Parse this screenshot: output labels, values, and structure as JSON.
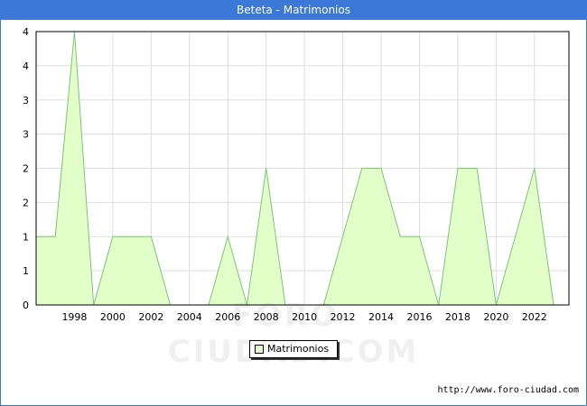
{
  "chart_data": {
    "type": "area",
    "title": "Beteta - Matrimonios",
    "xlabel": "",
    "ylabel": "",
    "x": [
      1996,
      1997,
      1998,
      1999,
      2000,
      2001,
      2002,
      2003,
      2004,
      2005,
      2006,
      2007,
      2008,
      2009,
      2010,
      2011,
      2012,
      2013,
      2014,
      2015,
      2016,
      2017,
      2018,
      2019,
      2020,
      2021,
      2022,
      2023
    ],
    "series": [
      {
        "name": "Matrimonios",
        "values": [
          1,
          1,
          4,
          0,
          1,
          1,
          1,
          0,
          0,
          0,
          1,
          0,
          2,
          0,
          0,
          0,
          1,
          2,
          2,
          1,
          1,
          0,
          2,
          2,
          0,
          1,
          2,
          0
        ]
      }
    ],
    "xlim": [
      1996,
      2023.8
    ],
    "ylim": [
      0,
      4
    ],
    "x_ticks": [
      1998,
      2000,
      2002,
      2004,
      2006,
      2008,
      2010,
      2012,
      2014,
      2016,
      2018,
      2020,
      2022
    ],
    "y_ticks": [
      {
        "value": 0,
        "label": "0"
      },
      {
        "value": 0.5,
        "label": "1"
      },
      {
        "value": 1,
        "label": "1"
      },
      {
        "value": 1.5,
        "label": "2"
      },
      {
        "value": 2,
        "label": "2"
      },
      {
        "value": 2.5,
        "label": "3"
      },
      {
        "value": 3,
        "label": "3"
      },
      {
        "value": 3.5,
        "label": "4"
      },
      {
        "value": 4,
        "label": "4"
      }
    ],
    "grid": true,
    "legend": "bottom-center",
    "colors": {
      "fill": "#e2ffc9",
      "line": "#7cc47a",
      "title_bar": "#3b78d8"
    }
  },
  "legend": {
    "label": "Matrimonios"
  },
  "watermark": "FORO-CIUDAD.COM",
  "source": "http://www.foro-ciudad.com"
}
